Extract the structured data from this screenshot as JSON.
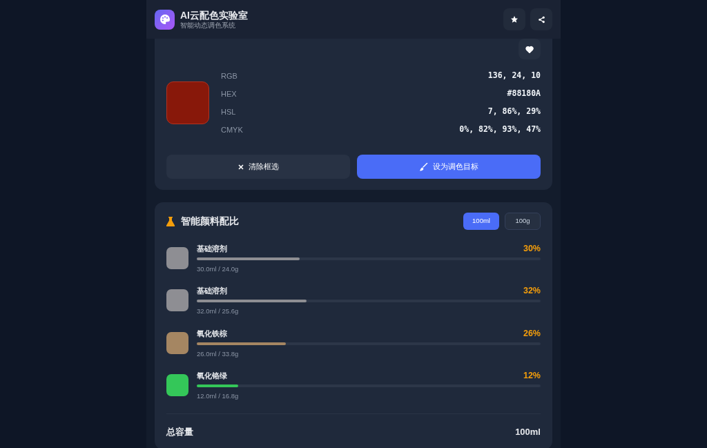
{
  "header": {
    "title": "AI云配色实验室",
    "subtitle": "智能动态调色系统"
  },
  "picker": {
    "favorite": true,
    "swatch": {
      "color": "#88180a"
    },
    "values": [
      {
        "label": "RGB",
        "value": "136, 24, 10"
      },
      {
        "label": "HEX",
        "value": "#88180A"
      },
      {
        "label": "HSL",
        "value": "7, 86%, 29%"
      },
      {
        "label": "CMYK",
        "value": "0%, 82%, 93%, 47%"
      }
    ],
    "buttons": [
      {
        "kind": "clear",
        "label": "清除框选"
      },
      {
        "kind": "target",
        "label": "设为调色目标"
      }
    ]
  },
  "ratio": {
    "title": "智能颜料配比",
    "units": [
      {
        "label": "100ml",
        "selected": true
      },
      {
        "label": "100g",
        "selected": false
      }
    ],
    "pigments": [
      {
        "name": "基础溶剂",
        "percent": "30%",
        "level": 0.3,
        "color": "#8e8e93",
        "amount": "30.0ml / 24.0g"
      },
      {
        "name": "基础溶剂",
        "percent": "32%",
        "level": 0.32,
        "color": "#8e8e93",
        "amount": "32.0ml / 25.6g"
      },
      {
        "name": "氧化铁棕",
        "percent": "26%",
        "level": 0.26,
        "color": "#a58662",
        "amount": "26.0ml / 33.8g"
      },
      {
        "name": "氧化铬绿",
        "percent": "12%",
        "level": 0.12,
        "color": "#34c759",
        "amount": "12.0ml / 16.8g"
      }
    ],
    "total": {
      "label": "总容量",
      "value": "100ml"
    }
  }
}
